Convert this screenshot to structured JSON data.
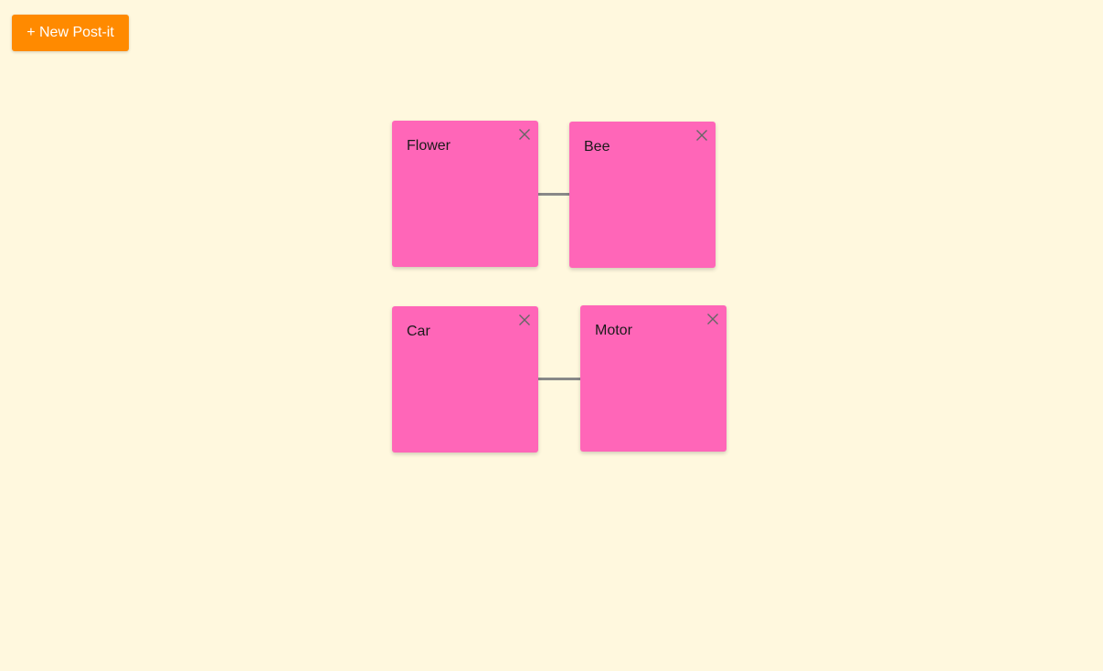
{
  "toolbar": {
    "new_postit_label": "+ New Post-it"
  },
  "notes": [
    {
      "text": "Flower"
    },
    {
      "text": "Bee"
    },
    {
      "text": "Car"
    },
    {
      "text": "Motor"
    }
  ],
  "connections": [
    {
      "from": "Flower",
      "to": "Bee"
    },
    {
      "from": "Car",
      "to": "Motor"
    }
  ],
  "colors": {
    "background": "#fff8de",
    "button": "#ff8a00",
    "note": "#ff66b8",
    "connector": "#888888"
  },
  "icons": {
    "close": "close-icon"
  }
}
